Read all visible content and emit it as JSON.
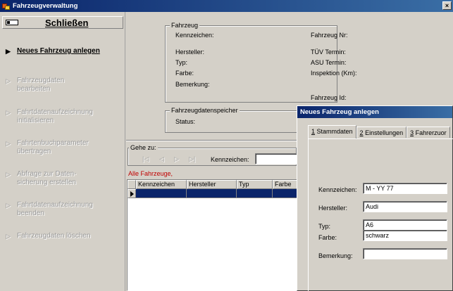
{
  "window": {
    "title": "Fahrzeugverwaltung",
    "close_glyph": "×"
  },
  "left_panel": {
    "close_label": "Schließen",
    "items": [
      {
        "label": "Neues Fahrzeug anlegen",
        "state": "active"
      },
      {
        "label": "Fahrzeugdaten\nbearbeiten",
        "state": "disabled"
      },
      {
        "label": "Fahrtdatenaufzeichnung\ninitialisieren",
        "state": "disabled"
      },
      {
        "label": "Fahrtenbuchparameter\nübertragen",
        "state": "disabled"
      },
      {
        "label": "Abfrage zur Daten-\nsicherung erstellen",
        "state": "disabled"
      },
      {
        "label": "Fahrtdatenaufzeichnung\nbeenden",
        "state": "disabled"
      },
      {
        "label": "Fahrzeugdaten löschen",
        "state": "disabled"
      }
    ]
  },
  "fahrzeug": {
    "legend": "Fahrzeug",
    "left_labels": [
      "Kennzeichen:",
      "Hersteller:",
      "Typ:",
      "Farbe:",
      "Bemerkung:"
    ],
    "right_labels": [
      "Fahrzeug Nr:",
      "TÜV Termin:",
      "ASU Termin:",
      "Inspektion (Km):",
      "Fahrzeug Id:"
    ]
  },
  "speicher": {
    "legend": "Fahrzeugdatenspeicher",
    "status_label": "Status:"
  },
  "goto": {
    "legend": "Gehe zu:",
    "nav": [
      "|◁",
      "◁",
      "▷",
      "▷|"
    ],
    "kennzeichen_label": "Kennzeichen:",
    "kennzeichen_value": ""
  },
  "grid": {
    "caption": "Alle Fahrzeuge,",
    "columns": [
      "Kennzeichen",
      "Hersteller",
      "Typ",
      "Farbe"
    ]
  },
  "dialog": {
    "title": "Neues Fahrzeug anlegen",
    "tabs": [
      {
        "key": "1",
        "label": " Stammdaten"
      },
      {
        "key": "2",
        "label": " Einstellungen"
      },
      {
        "key": "3",
        "label": " Fahrerzuor"
      }
    ],
    "fields": [
      {
        "label": "Kennzeichen:",
        "value": "M - YY 77"
      },
      {
        "label": "Hersteller:",
        "value": "Audi"
      },
      {
        "label": "Typ:",
        "value": "A6"
      },
      {
        "label": "Farbe:",
        "value": "schwarz"
      },
      {
        "label": "Bemerkung:",
        "value": ""
      }
    ]
  }
}
